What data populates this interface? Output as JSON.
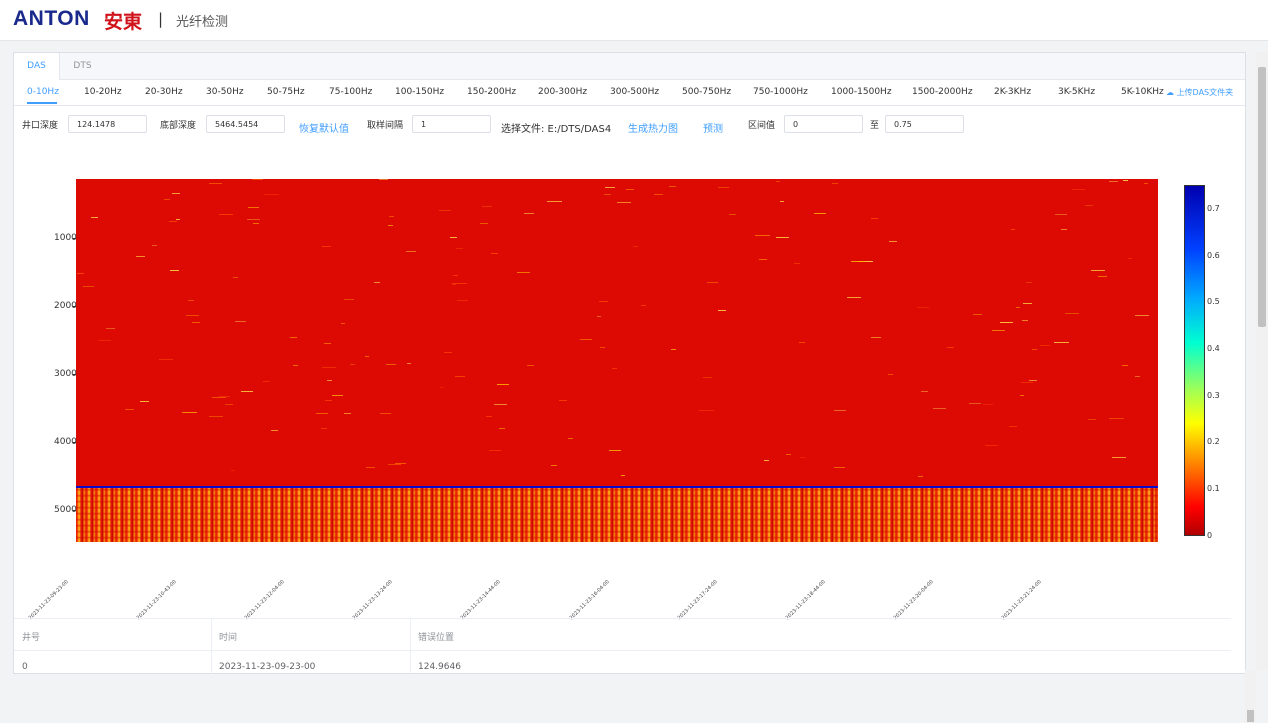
{
  "header": {
    "brand": "ANTON",
    "brand_cn": "安東",
    "separator": "|",
    "subtitle": "光纤检测"
  },
  "tabs": [
    {
      "label": "DAS",
      "active": true
    },
    {
      "label": "DTS",
      "active": false
    }
  ],
  "freq_bands": [
    "0-10Hz",
    "10-20Hz",
    "20-30Hz",
    "30-50Hz",
    "50-75Hz",
    "75-100Hz",
    "100-150Hz",
    "150-200Hz",
    "200-300Hz",
    "300-500Hz",
    "500-750Hz",
    "750-1000Hz",
    "1000-1500Hz",
    "1500-2000Hz",
    "2K-3KHz",
    "3K-5KHz",
    "5K-10KHz"
  ],
  "upload_label": "上传DAS文件夹",
  "controls": {
    "well_depth_label": "井口深度",
    "well_depth_value": "124.1478",
    "bottom_depth_label": "底部深度",
    "bottom_depth_value": "5464.5454",
    "restore_default": "恢复默认值",
    "interval_label": "取样间隔",
    "interval_value": "1",
    "file_label": "选择文件: E:/DTS/DAS4",
    "generate_heatmap": "生成热力图",
    "predict": "预测",
    "range_label": "区间值",
    "range_min": "0",
    "range_to": "至",
    "range_max": "0.75"
  },
  "chart_data": {
    "type": "heatmap",
    "y_ticks": [
      "1000",
      "2000",
      "3000",
      "4000",
      "5000"
    ],
    "x_ticks": [
      "2023-11-23-09-23-00",
      "2023-11-23-10-43-00",
      "2023-11-23-12-04-00",
      "2023-11-23-13-24-00",
      "2023-11-23-14-44-00",
      "2023-11-23-16-04-00",
      "2023-11-23-17-24-00",
      "2023-11-23-18-44-00",
      "2023-11-23-20-04-00",
      "2023-11-23-21-24-00"
    ],
    "colorbar_ticks": [
      "0.7",
      "0.6",
      "0.5",
      "0.4",
      "0.3",
      "0.2",
      "0.1",
      "0"
    ],
    "colorbar_range": [
      0,
      0.75
    ],
    "ylim": [
      124.1478,
      5464.5454
    ],
    "colors": [
      "#c80000",
      "#ff0000",
      "#ff8000",
      "#ffff00",
      "#00ffd0",
      "#0080ff",
      "#0000b0"
    ]
  },
  "table": {
    "headers": [
      "井号",
      "时间",
      "错误位置"
    ],
    "rows": [
      [
        "0",
        "2023-11-23-09-23-00",
        "124.9646"
      ]
    ]
  }
}
